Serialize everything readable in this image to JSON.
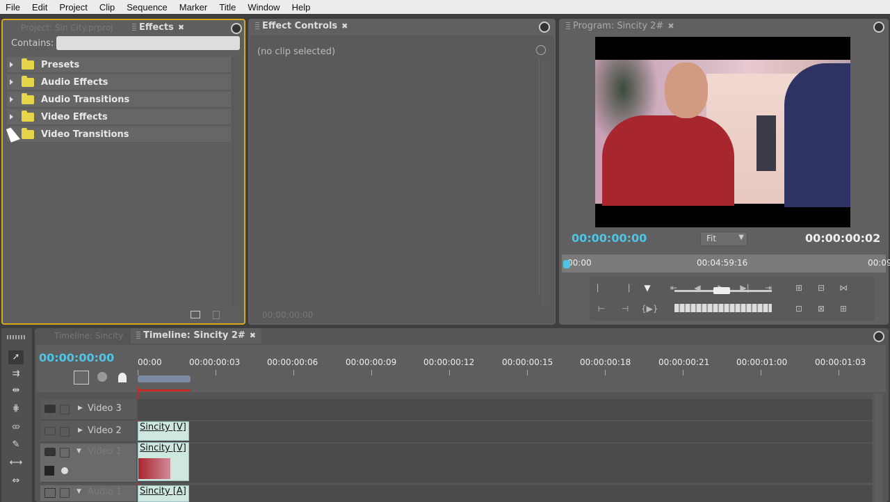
{
  "menu": [
    "File",
    "Edit",
    "Project",
    "Clip",
    "Sequence",
    "Marker",
    "Title",
    "Window",
    "Help"
  ],
  "effects_panel": {
    "tab_project": "Project: Sin City.prproj",
    "tab_effects": "Effects",
    "contains_label": "Contains:",
    "search_value": "",
    "folders": [
      "Presets",
      "Audio Effects",
      "Audio Transitions",
      "Video Effects",
      "Video Transitions"
    ]
  },
  "effect_controls": {
    "tab": "Effect Controls",
    "message": "(no clip selected)",
    "footer_time": "00:00:00:00"
  },
  "program": {
    "tab": "Program: Sincity 2#",
    "current_time": "00:00:00:00",
    "zoom": "Fit",
    "duration": "00:00:00:02",
    "ruler": [
      "00:00",
      "00:04:59:16",
      "00:09:"
    ]
  },
  "timeline": {
    "tab_inactive": "Timeline: Sincity",
    "tab_active": "Timeline: Sincity 2#",
    "timecode": "00:00:00:00",
    "ruler": [
      "00:00",
      "00:00:00:03",
      "00:00:00:06",
      "00:00:00:09",
      "00:00:00:12",
      "00:00:00:15",
      "00:00:00:18",
      "00:00:00:21",
      "00:00:01:00",
      "00:00:01:03"
    ],
    "tracks": [
      "Video 3",
      "Video 2",
      "Video 1",
      "Audio 1"
    ],
    "clips": {
      "v2": "Sincity [V]",
      "v1": "Sincity [V]",
      "a1": "Sincity [A]"
    }
  },
  "colors": {
    "accent_timecode": "#4ec5e6",
    "focus_border": "#d9a820",
    "folder": "#e8d64a"
  }
}
